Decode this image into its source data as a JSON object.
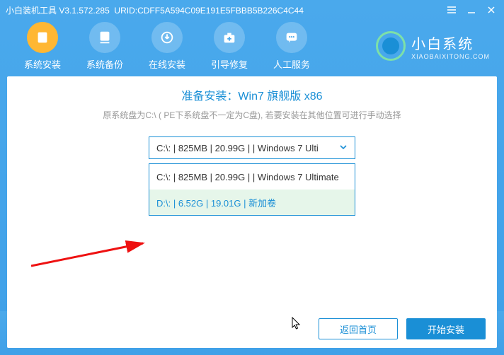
{
  "window": {
    "title_prefix": "小白装机工具 V",
    "version": "3.1.572.285",
    "urid_label": "URID:",
    "urid": "CDFF5A594C09E191E5FBBB5B226C4C44"
  },
  "logo": {
    "name": "小白系统",
    "domain": "XIAOBAIXITONG.COM"
  },
  "toolbar": [
    {
      "id": "install",
      "label": "系统安装",
      "active": true
    },
    {
      "id": "backup",
      "label": "系统备份",
      "active": false
    },
    {
      "id": "online",
      "label": "在线安装",
      "active": false
    },
    {
      "id": "bootfix",
      "label": "引导修复",
      "active": false
    },
    {
      "id": "support",
      "label": "人工服务",
      "active": false
    }
  ],
  "main": {
    "headline_prefix": "准备安装：",
    "headline_target": "Win7 旗舰版 x86",
    "subline": "原系统盘为C:\\ ( PE下系统盘不一定为C盘), 若要安装在其他位置可进行手动选择",
    "selected": "C:\\: | 825MB | 20.99G |  | Windows 7 Ulti",
    "options": [
      "C:\\: | 825MB | 20.99G |  | Windows 7 Ultimate",
      "D:\\: | 6.52G | 19.01G | 新加卷"
    ]
  },
  "footer": {
    "back": "返回首页",
    "start": "开始安装"
  }
}
